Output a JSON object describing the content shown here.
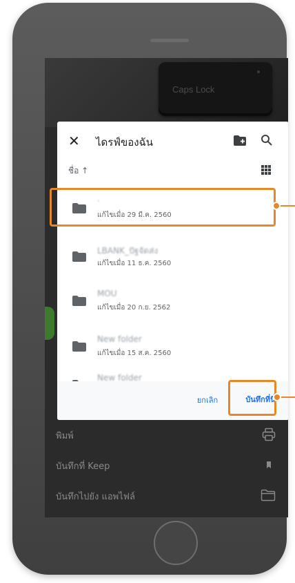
{
  "background_image": {
    "key_label": "Caps Lock"
  },
  "dialog": {
    "title": "ไดรฟ์ของฉัน",
    "sort_label": "ชื่อ ↑",
    "folders": [
      {
        "name": "·",
        "modified": "แก้ไขเมื่อ 29 มี.ค. 2560"
      },
      {
        "name": "LBANK_ปัฐจัดส่ง",
        "modified": "แก้ไขเมื่อ 11 ธ.ค. 2560"
      },
      {
        "name": "MOU",
        "modified": "แก้ไขเมื่อ 20 ก.ย. 2562"
      },
      {
        "name": "New folder",
        "modified": "แก้ไขเมื่อ 15 ส.ค. 2560"
      },
      {
        "name": "New folder",
        "modified": ""
      }
    ],
    "cancel_label": "ยกเลิก",
    "save_label": "บันทึกที่นี่"
  },
  "menu": {
    "items": [
      {
        "label": "พิมพ์",
        "icon": "print-icon"
      },
      {
        "label": "บันทึกที่ Keep",
        "icon": "bookmark-icon"
      },
      {
        "label": "บันทึกไปยัง แอพไฟล์",
        "icon": "folder-outline-icon"
      }
    ]
  },
  "colors": {
    "accent": "#1a73e8",
    "callout": "#e8862a",
    "folder": "#5f6368",
    "phone_body": "#4a4a4a"
  }
}
